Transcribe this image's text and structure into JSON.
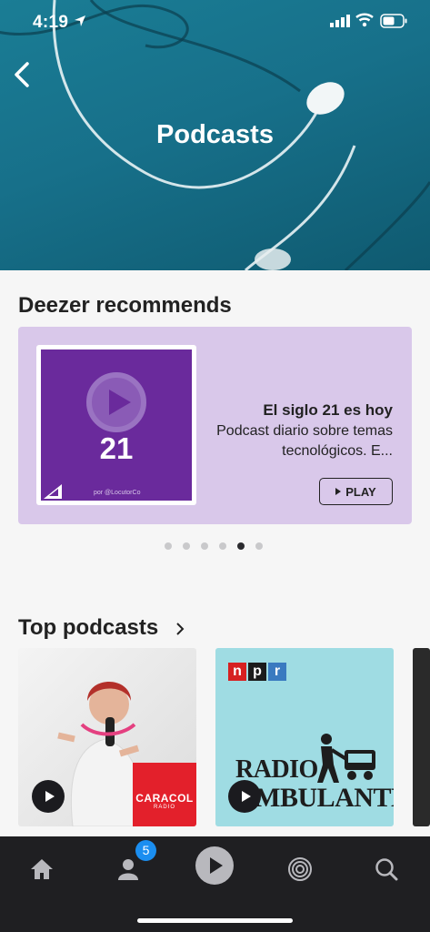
{
  "status": {
    "time": "4:19"
  },
  "header": {
    "title": "Podcasts"
  },
  "recommends": {
    "title": "Deezer recommends",
    "item": {
      "name": "El siglo 21 es hoy",
      "description": "Podcast diario sobre temas tecnológicos. E...",
      "cover_number": "21",
      "cover_credit": "por @LocutorCo",
      "play_label": "PLAY"
    },
    "carousel": {
      "count": 6,
      "active_index": 4
    }
  },
  "top_podcasts": {
    "title": "Top podcasts",
    "items": [
      {
        "logo_line1": "CARACOL",
        "logo_line2": "RADIO"
      },
      {
        "npr_letters": [
          "n",
          "p",
          "r"
        ],
        "title_line1": "RADIO",
        "title_line2": "AMBULANTE"
      },
      {}
    ]
  },
  "tabbar": {
    "tabs": [
      {
        "name": "home",
        "icon": "home-icon"
      },
      {
        "name": "profile",
        "icon": "person-icon"
      },
      {
        "name": "player",
        "icon": "play-icon"
      },
      {
        "name": "flow",
        "icon": "flow-icon"
      },
      {
        "name": "search",
        "icon": "search-icon"
      }
    ],
    "badge": "5"
  },
  "colors": {
    "hero": "#17708a",
    "card": "#d9c8ea",
    "cover": "#6a2a9c",
    "tabbar": "#1f1f22",
    "badge": "#1b8ef0"
  }
}
